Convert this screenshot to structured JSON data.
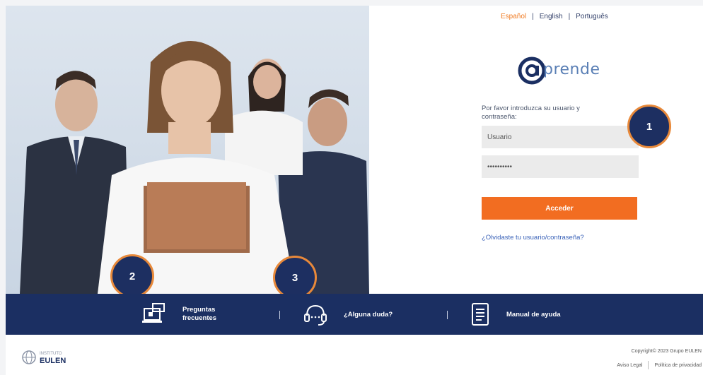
{
  "languages": {
    "spanish": "Español",
    "english": "English",
    "portuguese": "Português",
    "active_color": "#f07a21"
  },
  "logo": {
    "wordmark": "prende",
    "at_symbol": "@"
  },
  "login": {
    "prompt": "Por favor introduzca su usuario y contraseña:",
    "username_value": "Usuario",
    "password_value": "••••••••••",
    "submit_label": "Acceder",
    "forgot_link": "¿Olvidaste tu usuario/contraseña?"
  },
  "callouts": {
    "one": "1",
    "two": "2",
    "three": "3"
  },
  "help_bar": {
    "faq_line1": "Preguntas",
    "faq_line2": "frecuentes",
    "question_label": "¿Alguna duda?",
    "manual_label": "Manual de ayuda",
    "icons": [
      "faq-laptop-icon",
      "headset-icon",
      "document-icon"
    ]
  },
  "footer": {
    "brand_small": "INSTITUTO",
    "brand_name": "EULEN",
    "copyright": "Copyright© 2023 Grupo EULEN",
    "legal_notice": "Aviso Legal",
    "privacy_policy": "Política de privacidad"
  },
  "colors": {
    "navy": "#1b2f62",
    "orange": "#f26d21",
    "link_blue": "#3a62b8"
  }
}
